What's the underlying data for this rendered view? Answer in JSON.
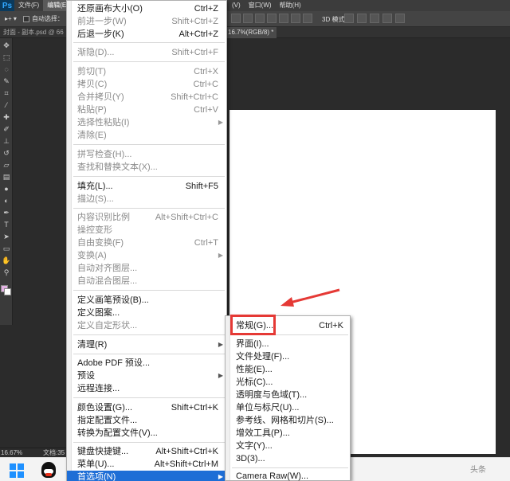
{
  "app": {
    "logo": "Ps",
    "menubar": {
      "file": "文件(F)",
      "edit": "编辑(E)",
      "view": "(V)",
      "window": "窗口(W)",
      "help": "帮助(H)"
    },
    "options": {
      "auto_select": "自动选择：",
      "mode_3d": "3D 模式："
    },
    "tabs": {
      "doc1": "封面 - 副本.psd @ 66",
      "doc2": "16.7%(RGB/8) *"
    },
    "status": {
      "zoom": "16.67%",
      "doc": "文档:35"
    }
  },
  "edit_menu": {
    "items": [
      {
        "label": "还原画布大小(O)",
        "shortcut": "Ctrl+Z"
      },
      {
        "label": "前进一步(W)",
        "shortcut": "Shift+Ctrl+Z"
      },
      {
        "label": "后退一步(K)",
        "shortcut": "Alt+Ctrl+Z"
      },
      {
        "label": "渐隐(D)...",
        "shortcut": "Shift+Ctrl+F"
      },
      {
        "label": "剪切(T)",
        "shortcut": "Ctrl+X"
      },
      {
        "label": "拷贝(C)",
        "shortcut": "Ctrl+C"
      },
      {
        "label": "合并拷贝(Y)",
        "shortcut": "Shift+Ctrl+C"
      },
      {
        "label": "粘贴(P)",
        "shortcut": "Ctrl+V"
      },
      {
        "label": "选择性粘贴(I)",
        "shortcut": ""
      },
      {
        "label": "清除(E)",
        "shortcut": ""
      },
      {
        "label": "拼写检查(H)...",
        "shortcut": ""
      },
      {
        "label": "查找和替换文本(X)...",
        "shortcut": ""
      },
      {
        "label": "填充(L)...",
        "shortcut": "Shift+F5"
      },
      {
        "label": "描边(S)...",
        "shortcut": ""
      },
      {
        "label": "内容识别比例",
        "shortcut": "Alt+Shift+Ctrl+C"
      },
      {
        "label": "操控变形",
        "shortcut": ""
      },
      {
        "label": "自由变换(F)",
        "shortcut": "Ctrl+T"
      },
      {
        "label": "变换(A)",
        "shortcut": ""
      },
      {
        "label": "自动对齐图层...",
        "shortcut": ""
      },
      {
        "label": "自动混合图层...",
        "shortcut": ""
      },
      {
        "label": "定义画笔预设(B)...",
        "shortcut": ""
      },
      {
        "label": "定义图案...",
        "shortcut": ""
      },
      {
        "label": "定义自定形状...",
        "shortcut": ""
      },
      {
        "label": "清理(R)",
        "shortcut": ""
      },
      {
        "label": "Adobe PDF 预设...",
        "shortcut": ""
      },
      {
        "label": "预设",
        "shortcut": ""
      },
      {
        "label": "远程连接...",
        "shortcut": ""
      },
      {
        "label": "颜色设置(G)...",
        "shortcut": "Shift+Ctrl+K"
      },
      {
        "label": "指定配置文件...",
        "shortcut": ""
      },
      {
        "label": "转换为配置文件(V)...",
        "shortcut": ""
      },
      {
        "label": "键盘快捷键...",
        "shortcut": "Alt+Shift+Ctrl+K"
      },
      {
        "label": "菜单(U)...",
        "shortcut": "Alt+Shift+Ctrl+M"
      },
      {
        "label": "首选项(N)",
        "shortcut": ""
      }
    ]
  },
  "prefs_submenu": {
    "items": [
      {
        "label": "常规(G)...",
        "shortcut": "Ctrl+K"
      },
      {
        "label": "界面(I)...",
        "shortcut": ""
      },
      {
        "label": "文件处理(F)...",
        "shortcut": ""
      },
      {
        "label": "性能(E)...",
        "shortcut": ""
      },
      {
        "label": "光标(C)...",
        "shortcut": ""
      },
      {
        "label": "透明度与色域(T)...",
        "shortcut": ""
      },
      {
        "label": "单位与标尺(U)...",
        "shortcut": ""
      },
      {
        "label": "参考线、网格和切片(S)...",
        "shortcut": ""
      },
      {
        "label": "增效工具(P)...",
        "shortcut": ""
      },
      {
        "label": "文字(Y)...",
        "shortcut": ""
      },
      {
        "label": "3D(3)...",
        "shortcut": ""
      },
      {
        "label": "Camera Raw(W)...",
        "shortcut": ""
      }
    ]
  },
  "taskbar": {
    "watermark": "头条"
  },
  "colors": {
    "highlight": "#1e6ed6",
    "annotation": "#e53935",
    "foreground_swatch": "#e4b2e4"
  }
}
